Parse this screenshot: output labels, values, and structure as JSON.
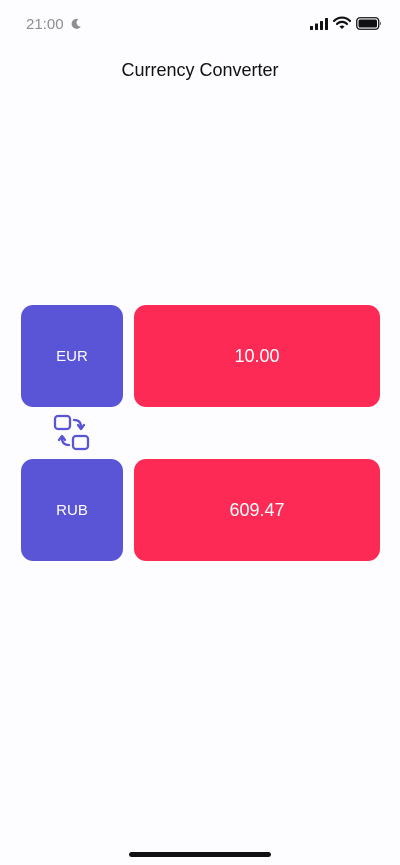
{
  "status_bar": {
    "time": "21:00",
    "icons": [
      "moon-icon",
      "signal-icon",
      "wifi-icon",
      "battery-icon"
    ]
  },
  "header": {
    "title": "Currency Converter"
  },
  "converter": {
    "from": {
      "currency": "EUR",
      "amount": "10.00"
    },
    "to": {
      "currency": "RUB",
      "amount": "609.47"
    },
    "swap_icon": "swap-icon"
  },
  "colors": {
    "currency_button": "#5a55d6",
    "amount_field": "#fc2a54",
    "swap_icon": "#5a55d6",
    "background": "#fdfcfe"
  }
}
